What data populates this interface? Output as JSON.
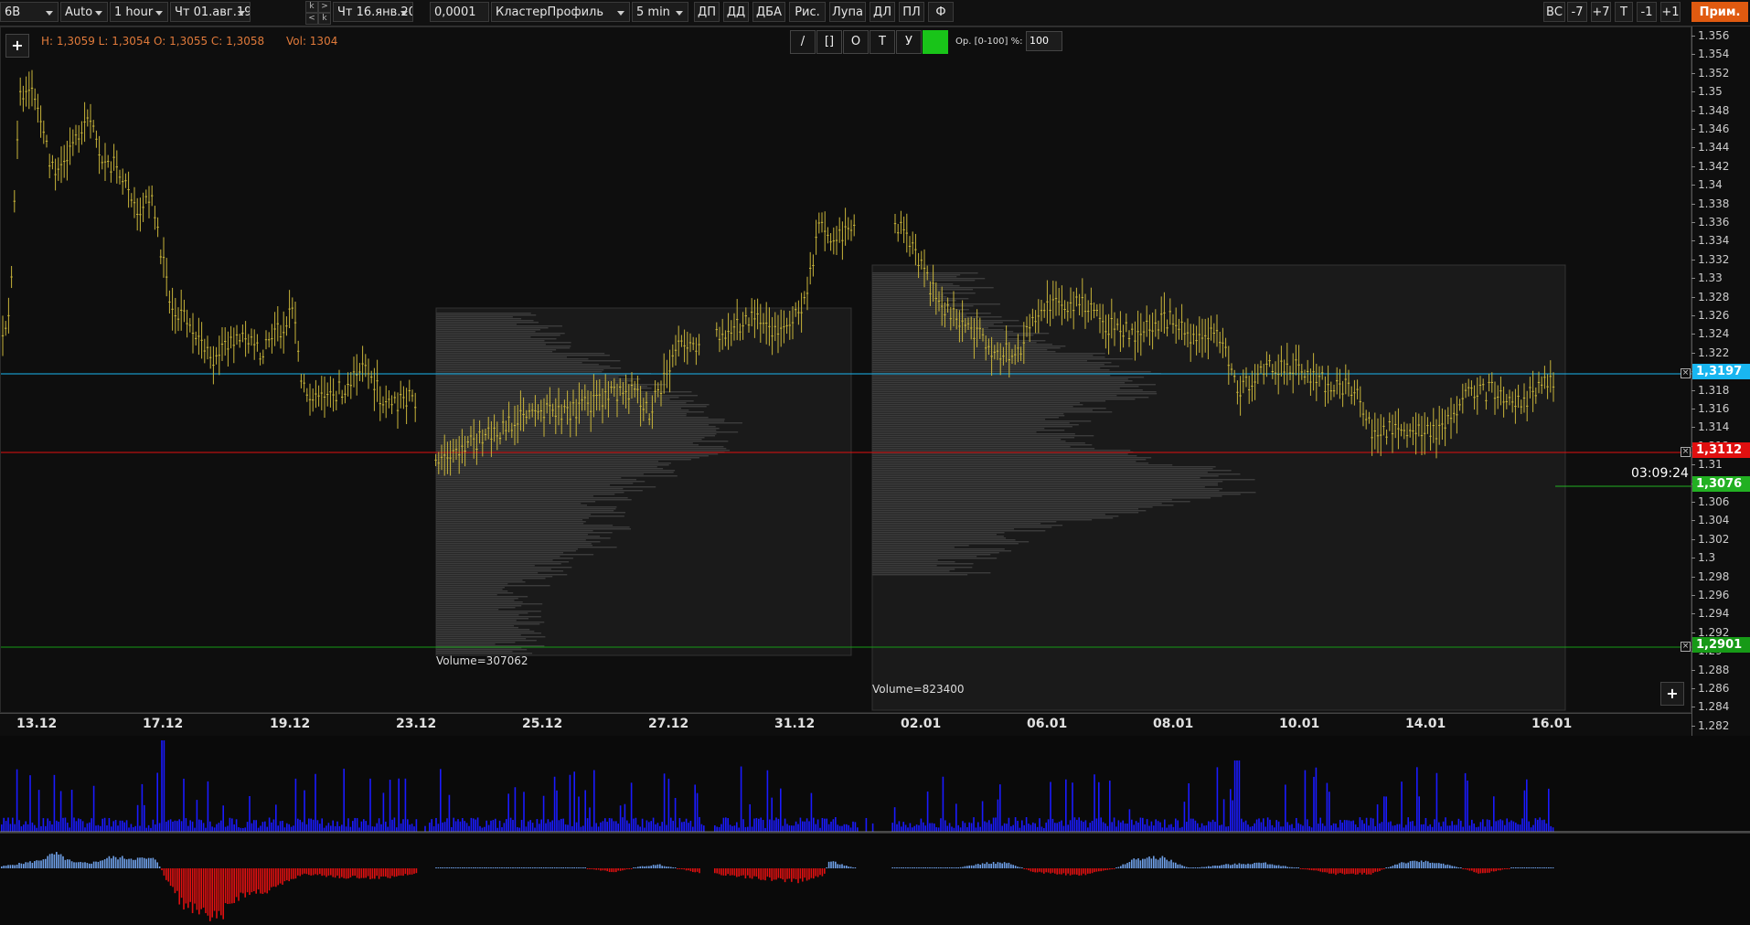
{
  "toolbar": {
    "symbol": "6B",
    "scale": "Auto",
    "timeframe": "1 hour",
    "date_from": "Чт 01.авг.19",
    "arrow_labels": [
      "k",
      ">",
      "<",
      "k"
    ],
    "date_to": "Чт 16.янв.20",
    "tick_size": "0,0001",
    "profile_type": "КластерПрофиль",
    "profile_tf": "5 min",
    "buttons": [
      "ДП",
      "ДД",
      "ДБА",
      "Рис.",
      "Лупа",
      "ДЛ",
      "ПЛ",
      "Ф"
    ],
    "right_buttons": [
      "ВС",
      "-7",
      "+7",
      "T",
      "-1",
      "+1"
    ],
    "apply_label": "Прим."
  },
  "ohlc": {
    "text": "H: 1,3059 L: 1,3054 O: 1,3055 C: 1,3058",
    "vol": "Vol: 1304"
  },
  "draw_tools": {
    "buttons": [
      "/",
      "[]",
      "O",
      "T",
      "У"
    ],
    "opacity_label": "Op. [0-100] %:",
    "opacity_value": "100"
  },
  "plus_label": "+",
  "volume_profiles": [
    {
      "label": "Volume=307062"
    },
    {
      "label": "Volume=823400"
    }
  ],
  "timer": "03:09:24",
  "price_tags": [
    {
      "value": "1,3197",
      "color": "#19b6f0"
    },
    {
      "value": "1,3112",
      "color": "#e01010"
    },
    {
      "value": "1,3076",
      "color": "#22b022"
    },
    {
      "value": "1,2901",
      "color": "#179a17"
    }
  ],
  "y_ticks": [
    "1.356",
    "1.354",
    "1.352",
    "1.35",
    "1.348",
    "1.346",
    "1.344",
    "1.342",
    "1.34",
    "1.338",
    "1.336",
    "1.334",
    "1.332",
    "1.33",
    "1.328",
    "1.326",
    "1.324",
    "1.322",
    "1.32",
    "1.318",
    "1.316",
    "1.314",
    "1.312",
    "1.31",
    "1.308",
    "1.306",
    "1.304",
    "1.302",
    "1.3",
    "1.298",
    "1.296",
    "1.294",
    "1.292",
    "1.29",
    "1.288",
    "1.286",
    "1.284",
    "1.282"
  ],
  "x_ticks": [
    "13.12",
    "17.12",
    "19.12",
    "23.12",
    "25.12",
    "27.12",
    "31.12",
    "02.01",
    "06.01",
    "08.01",
    "10.01",
    "14.01",
    "16.01"
  ],
  "colors": {
    "bars": "#c8b43a",
    "line_blue": "#19b6f0",
    "line_red": "#e01010",
    "line_green": "#179a17",
    "volume": "#1a1aff",
    "delta_pos": "#6fa0e8",
    "delta_neg": "#e01010",
    "accent": "#e05a10"
  }
}
